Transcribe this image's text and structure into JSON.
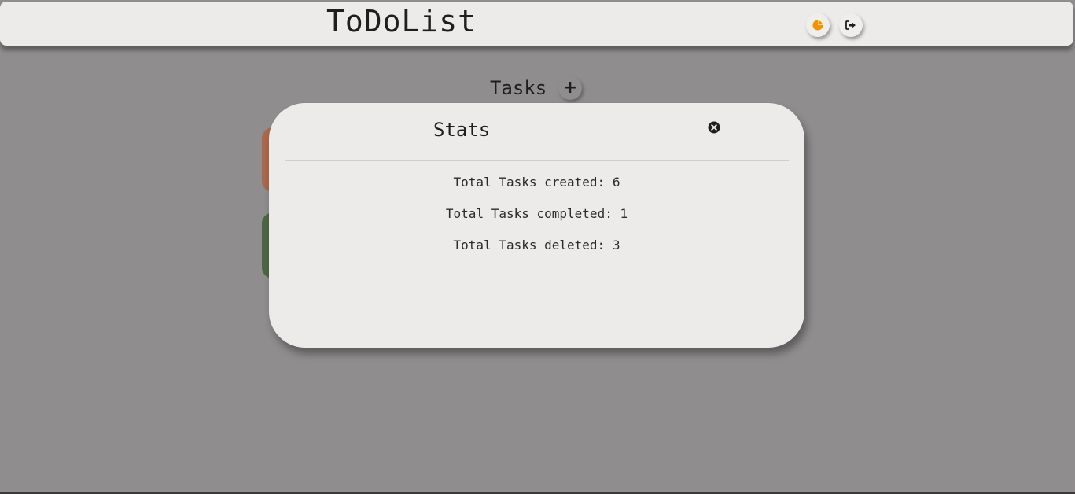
{
  "header": {
    "title": "ToDoList",
    "stats_button_icon": "pie-chart-icon",
    "logout_button_icon": "sign-out-icon",
    "stats_icon_color": "#f39200"
  },
  "tasks": {
    "heading": "Tasks",
    "add_label": "+"
  },
  "task_cards": [
    {
      "color": "#a9694a"
    },
    {
      "color": "#4c6645"
    }
  ],
  "stats_modal": {
    "title": "Stats",
    "close_icon": "close-circle-icon",
    "lines": [
      "Total Tasks created: 6",
      "Total Tasks completed: 1",
      "Total Tasks deleted: 3"
    ]
  }
}
